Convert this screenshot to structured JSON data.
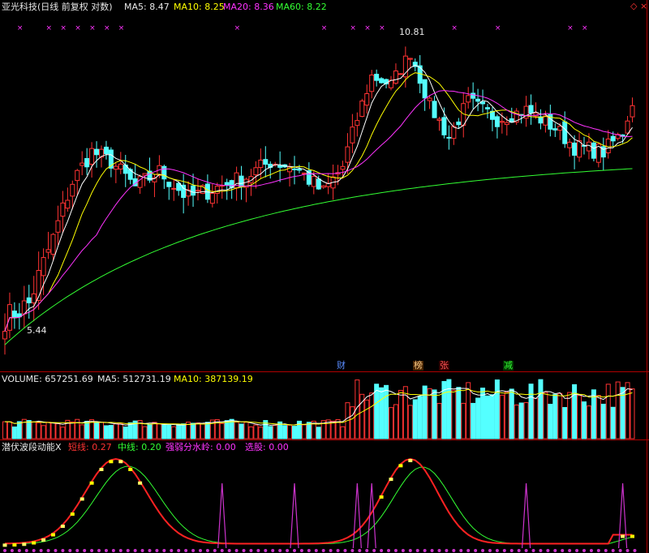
{
  "chart_data": [
    {
      "type": "candlestick",
      "title": "亚光科技(日线 前复权 对数)",
      "scale": "log",
      "indicators": {
        "ma5_label": "MA5: 8.47",
        "ma10_label": "MA10: 8.25",
        "ma20_label": "MA20: 8.36",
        "ma60_label": "MA60: 8.22"
      },
      "price_range": [
        4.9,
        11.6
      ],
      "annotations": {
        "max_label": "10.81",
        "min_label": "5.44",
        "max": 10.81,
        "min": 5.44
      },
      "signal_badges": [
        "财",
        "榜",
        "张",
        "减"
      ],
      "colors": {
        "up": "#ff3333",
        "down": "#54ffff",
        "ma5": "#ffffff",
        "ma10": "#ffff00",
        "ma20": "#ff33ff",
        "ma60": "#33ff33"
      }
    },
    {
      "type": "bar",
      "title": "VOLUME",
      "indicators": {
        "volume_label": "VOLUME: 657251.69",
        "ma5_label": "MA5: 512731.19",
        "ma10_label": "MA10: 387139.19"
      }
    },
    {
      "type": "line",
      "title": "潜伏波段动能X",
      "indicators": {
        "short_label": "短线: 0.27",
        "mid_label": "中线: 0.20",
        "ridge_label": "强弱分水岭: 0.00",
        "pick_label": "选股: 0.00"
      }
    }
  ]
}
